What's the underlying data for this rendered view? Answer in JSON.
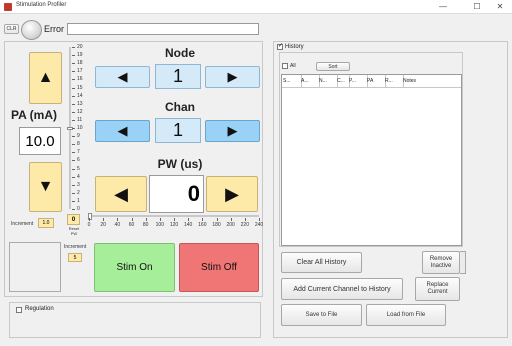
{
  "window": {
    "title": "Stimulation Profiler",
    "min_glyph": "—",
    "max_glyph": "☐",
    "close_glyph": "✕"
  },
  "status": {
    "clr_label": "CLR",
    "error_label": "Error",
    "error_text": ""
  },
  "pa": {
    "label": "PA (mA)",
    "value": "10.0",
    "up_glyph": "▲",
    "down_glyph": "▼",
    "increment_label": "Increment",
    "increment_value": "1.0",
    "scale_ticks": [
      "20",
      "19",
      "18",
      "17",
      "16",
      "15",
      "14",
      "13",
      "12",
      "11",
      "10",
      "9",
      "8",
      "7",
      "6",
      "5",
      "4",
      "3",
      "2",
      "1",
      "0"
    ],
    "scale_value": 10,
    "scale_min": 0,
    "scale_max": 20
  },
  "node": {
    "label": "Node",
    "value": "1",
    "left_glyph": "◀",
    "right_glyph": "▶"
  },
  "chan": {
    "label": "Chan",
    "value": "1",
    "left_glyph": "◀",
    "right_glyph": "▶"
  },
  "pw": {
    "label": "PW (us)",
    "value": "0",
    "left_glyph": "◀",
    "right_glyph": "▶",
    "reset_value": "0",
    "reset_label_line1": "Reset",
    "reset_label_line2": "PW",
    "increment_label": "Increment",
    "increment_value": "5",
    "slider_ticks": [
      "0",
      "20",
      "40",
      "60",
      "80",
      "100",
      "120",
      "140",
      "160",
      "180",
      "200",
      "220",
      "240"
    ],
    "slider_value": 0,
    "slider_min": 0,
    "slider_max": 240
  },
  "stim": {
    "on_label": "Stim On",
    "off_label": "Stim Off"
  },
  "regulation": {
    "label": "Regulation",
    "checked": false
  },
  "history": {
    "title": "History",
    "title_checked": true,
    "all_label": "All",
    "all_checked": false,
    "sort_label": "Sort",
    "columns": [
      "S...",
      "A...",
      "N...",
      "C...",
      "P...",
      "PA",
      "R...",
      "Notes"
    ],
    "rows": [],
    "clear_all_label": "Clear All History",
    "remove_inactive_line1": "Remove",
    "remove_inactive_line2": "Inactive",
    "add_current_label": "Add Current Channel to History",
    "replace_current_line1": "Replace",
    "replace_current_line2": "Current",
    "save_label": "Save to File",
    "load_label": "Load from File"
  },
  "colors": {
    "yellow_button": "#fde9a8",
    "blue_button": "#9ad2f7",
    "value_box": "#d5eaf9",
    "stim_on": "#a6ee9a",
    "stim_off": "#f07575"
  }
}
